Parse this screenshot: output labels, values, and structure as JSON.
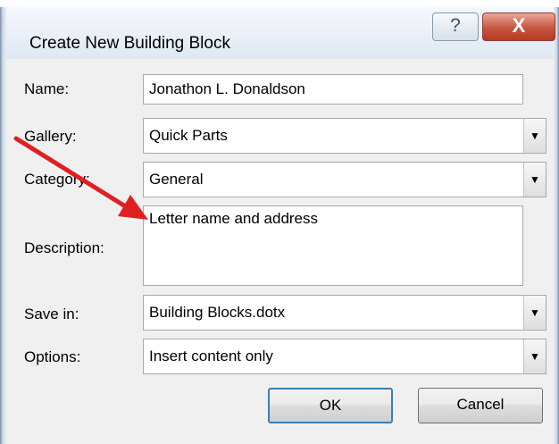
{
  "window": {
    "title": "Create New Building Block",
    "help_label": "?",
    "close_label": "X"
  },
  "form": {
    "name": {
      "label": "Name:",
      "value": "Jonathon L. Donaldson"
    },
    "gallery": {
      "label": "Gallery:",
      "value": "Quick Parts"
    },
    "category": {
      "label": "Category:",
      "value": "General"
    },
    "description": {
      "label": "Description:",
      "value": "Letter name and address"
    },
    "save_in": {
      "label": "Save in:",
      "value": "Building Blocks.dotx"
    },
    "options": {
      "label": "Options:",
      "value": "Insert content only"
    }
  },
  "buttons": {
    "ok": "OK",
    "cancel": "Cancel"
  },
  "combo_arrow_glyph": "▼",
  "annotation": {
    "color": "#e02020",
    "icon": "red-arrow"
  }
}
